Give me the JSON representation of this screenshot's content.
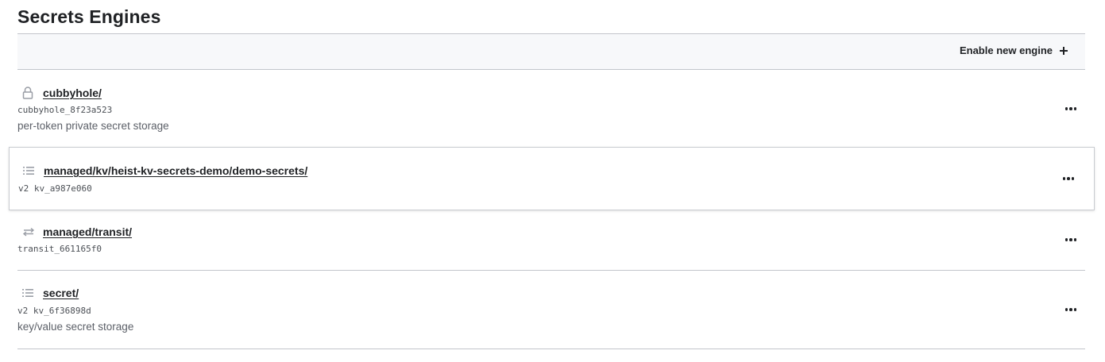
{
  "page": {
    "title": "Secrets Engines"
  },
  "toolbar": {
    "enable_label": "Enable new engine",
    "enable_icon": "plus-icon"
  },
  "engines": [
    {
      "path": "cubbyhole/",
      "icon": "lock-icon",
      "meta": "cubbyhole_8f23a523",
      "description": "per-token private secret storage"
    },
    {
      "path": "managed/kv/heist-kv-secrets-demo/demo-secrets/",
      "icon": "list-icon",
      "meta": "v2 kv_a987e060",
      "description": ""
    },
    {
      "path": "managed/transit/",
      "icon": "swap-arrows-icon",
      "meta": "transit_661165f0",
      "description": ""
    },
    {
      "path": "secret/",
      "icon": "list-icon",
      "meta": "v2 kv_6f36898d",
      "description": "key/value secret storage"
    }
  ],
  "colors": {
    "text": "#1f2124",
    "muted": "#5c6068",
    "border": "#c2c5cb",
    "toolbar_bg": "#f7f8fa",
    "icon": "#9a9ea6"
  }
}
